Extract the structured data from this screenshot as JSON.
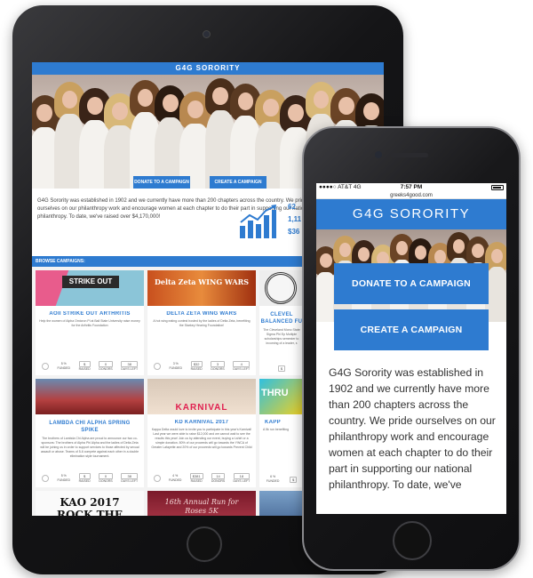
{
  "site": {
    "title": "G4G SORORITY",
    "url": "greeks4good.com"
  },
  "buttons": {
    "donate": "DONATE TO A CAMPAIGN",
    "create": "CREATE A CAMPAIGN"
  },
  "intro": "G4G Sorority was established in 1902 and we currently have more than 200 chapters across the country. We pride ourselves on our philanthropy work and encourage women at each chapter to do their part in supporting our national philanthropy. To date, we've raised over $4,170,000!",
  "phone_intro": "G4G Sorority was established in 1902 and we currently have more than 200 chapters across the country. We pride ourselves on our philanthropy work and encourage women at each chapter to do their part in supporting our national philanthropy. To date, we've",
  "stats": {
    "s1": "62",
    "s2": "1,11",
    "s3": "$36"
  },
  "browse_label": "BROWSE CAMPAIGNS:",
  "campaigns": [
    {
      "title": "AOII STRIKE OUT ARTHRITIS",
      "img_text": "STRIKE OUT",
      "desc": "Help the women of Alpha Omicron Pi at Ball State University raise money for the Arthritis Foundation",
      "funded": "5 %",
      "raised": "$",
      "donors": "0",
      "days": "38"
    },
    {
      "title": "DELTA ZETA WING WARS",
      "img_text": "Delta Zeta WING WARS",
      "desc": "A hot wing eating contest hosted by the ladies of Delta Zeta, benefiting the Starkey Hearing Foundation!",
      "funded": "3 %",
      "raised": "$32",
      "donors": "3",
      "days": "4"
    },
    {
      "title": "CLEVEL BALANCED FU",
      "img_text": "",
      "desc": "The Cleveland Mono State Sigma Phi Ep Multiple scholarships semester to incoming of a leader, s",
      "funded": "",
      "raised": "$",
      "donors": "",
      "days": ""
    },
    {
      "title": "LAMBDA CHI ALPHA SPRING SPIKE",
      "img_text": "",
      "desc": "The brothers of Lambda Chi Alpha are proud to announce our two co-sponsors: The brothers of Alpha Phi Alpha and the ladies of Delta Zeta will be joining us in order to support services to those affected by sexual assault or abuse. Teams of 5-6 compete against each other in a double elimination style tournament.",
      "funded": "5 %",
      "raised": "$",
      "donors": "0",
      "days": "38"
    },
    {
      "title": "KD KARNIVAL 2017",
      "img_text": "KARNIVAL",
      "desc": "Kappa Delta would love to invite you to participate in this year's Karnival! Last year we were able to raise $12,000 and we cannot wait to see the results this year! Join us by attending our event, buying a t-shirt or a simple donation. 80% of our proceeds will go towards the YWCA of Greater Lafayette and 20% of our proceeds will go towards Prevent Child Abuse America.",
      "funded": "4 %",
      "raised": "$381",
      "donors": "14",
      "days": "18"
    },
    {
      "title": "KAPP",
      "img_text": "THRU",
      "desc": "A 5k run benefiting",
      "funded": "6 %",
      "raised": "$",
      "donors": "",
      "days": ""
    },
    {
      "title": "",
      "img_text": "KAO 2017 ROCK THE CASA",
      "desc": "",
      "funded": "",
      "raised": "",
      "donors": "",
      "days": ""
    },
    {
      "title": "",
      "img_text": "16th Annual Run for Roses 5K",
      "desc": "",
      "funded": "",
      "raised": "",
      "donors": "",
      "days": ""
    }
  ],
  "stat_labels": {
    "funded": "FUNDED",
    "raised": "RAISED",
    "donors": "DONORS",
    "days": "DAYS LEFT"
  },
  "phone_status": {
    "carrier": "●●●●○ AT&T  4G",
    "time": "7:57 PM"
  },
  "colors": {
    "brand_blue": "#2e7bd0",
    "device_black": "#121214"
  }
}
